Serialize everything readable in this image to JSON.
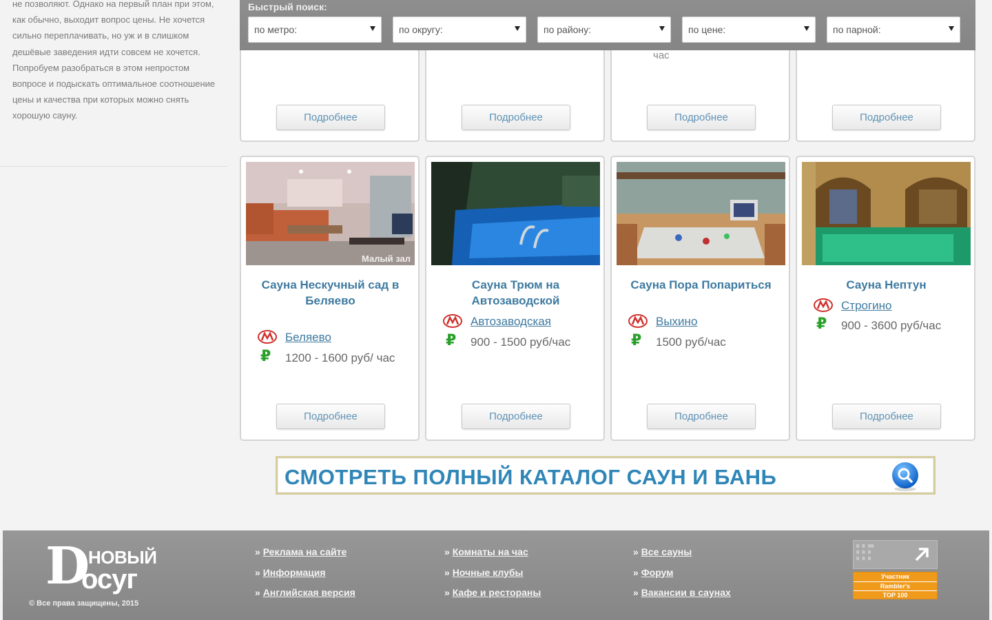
{
  "sidebar": {
    "text": "не позволяют. Однако на первый план при этом, как обычно, выходит вопрос цены. Не хочется сильно переплачивать, но уж и в слишком дешёвые заведения идти совсем не хочется. Попробуем разобраться в этом непростом вопросе и подыскать оптимальное соотношение цены и качества при которых можно снять хорошую сауну."
  },
  "quick_search": {
    "title": "Быстрый поиск:",
    "filters": [
      "по метро:",
      "по округу:",
      "по району:",
      "по цене:",
      "по парной:"
    ]
  },
  "top_cards": {
    "note": "час",
    "details_label": "Подробнее"
  },
  "cards": [
    {
      "title": "Сауна Нескучный сад в Беляево",
      "photo_caption": "Малый зал",
      "metro": "Беляево",
      "price": "1200 - 1600 руб/ час",
      "details_label": "Подробнее"
    },
    {
      "title": "Сауна Трюм на Автозаводской",
      "photo_caption": "",
      "metro": "Автозаводская",
      "price": "900 - 1500 руб/час",
      "details_label": "Подробнее"
    },
    {
      "title": "Сауна Пора Попариться",
      "photo_caption": "",
      "metro": "Выхино",
      "price": "1500 руб/час",
      "details_label": "Подробнее"
    },
    {
      "title": "Сауна Нептун",
      "photo_caption": "",
      "metro": "Строгино",
      "price": "900 - 3600 руб/час",
      "details_label": "Подробнее"
    }
  ],
  "icons": {
    "metro": "metro-icon",
    "price": "ruble-icon",
    "catalog": "search-icon"
  },
  "catalog_banner": {
    "text": "СМОТРЕТЬ ПОЛНЫЙ КАТАЛОГ САУН И БАНЬ"
  },
  "footer": {
    "logo_top": "НОВЫЙ",
    "logo_bottom": "осуг",
    "logo_letter": "D",
    "copyright": "© Все права защищены, 2015",
    "columns": [
      [
        "Реклама на сайте",
        "Информация",
        "Английская версия"
      ],
      [
        "Комнаты на час",
        "Ночные клубы",
        "Кафе и рестораны"
      ],
      [
        "Все сауны",
        "Форум",
        "Вакансии в саунах"
      ]
    ],
    "counter_digits": "0 0 00\n0 0 0\n0 0 0",
    "rambler_lines": [
      "Участник",
      "Rambler's",
      "TOP 100"
    ]
  },
  "colors": {
    "accent_blue": "#3e7aa0",
    "price_green": "#2aa02a",
    "metro_red": "#d0312d",
    "footer_gray": "#8c8c8c",
    "rambler_orange": "#f09a1c"
  }
}
